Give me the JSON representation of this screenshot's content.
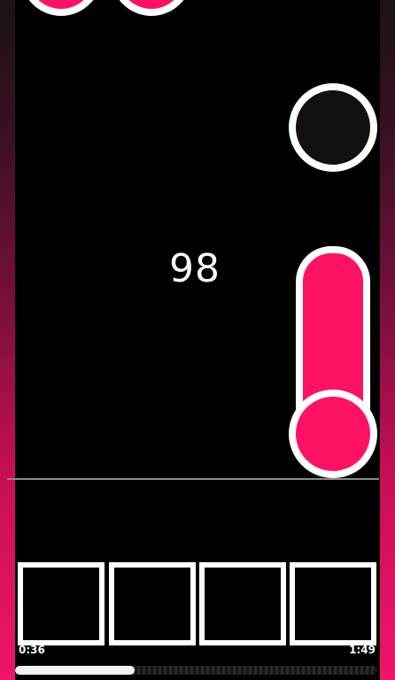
{
  "game": {
    "score": "98",
    "elapsed": "0:36",
    "duration": "1:49",
    "progress_fraction": 0.33,
    "lanes": 4
  },
  "colors": {
    "note_pink": "#ff1166",
    "note_dark": "#141010",
    "outline": "#ffffff",
    "background": "#000000",
    "side_gradient_top": "#1a1216",
    "side_gradient_bottom": "#f0156a"
  },
  "notes": [
    {
      "lane": 1,
      "type": "tap",
      "color": "note_pink"
    },
    {
      "lane": 2,
      "type": "tap",
      "color": "note_pink"
    },
    {
      "lane": 4,
      "type": "tap",
      "color": "note_dark"
    },
    {
      "lane": 4,
      "type": "hold",
      "color": "note_pink"
    }
  ]
}
